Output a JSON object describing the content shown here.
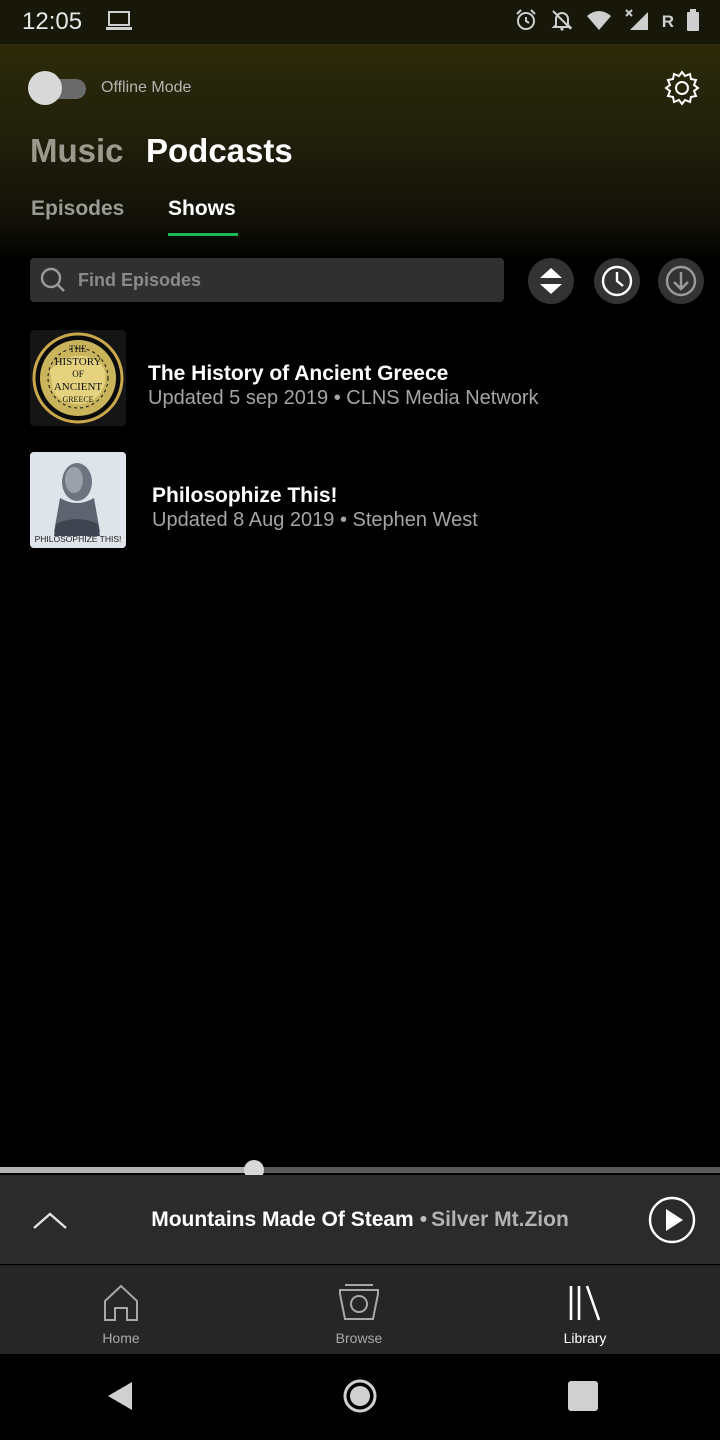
{
  "status_bar": {
    "time": "12:05",
    "carrier_indicator": "R",
    "icons": [
      "laptop-icon",
      "alarm-icon",
      "notifications-off-icon",
      "wifi-icon",
      "cell-signal-icon",
      "battery-icon"
    ]
  },
  "header": {
    "offline_mode": {
      "label": "Offline Mode",
      "enabled": false
    },
    "main_tabs": [
      {
        "label": "Music",
        "active": false
      },
      {
        "label": "Podcasts",
        "active": true
      }
    ],
    "sub_tabs": [
      {
        "label": "Episodes",
        "active": false
      },
      {
        "label": "Shows",
        "active": true
      }
    ],
    "accent_color": "#1db954"
  },
  "search": {
    "placeholder": "Find Episodes",
    "value": ""
  },
  "toolbar": {
    "buttons": [
      "sort-icon",
      "recent-clock-icon",
      "download-icon"
    ]
  },
  "shows": [
    {
      "title": "The History of Ancient Greece",
      "meta": "Updated 5 sep 2019 • CLNS Media Network",
      "cover_text": [
        "THE",
        "HISTORY",
        "OF",
        "ANCIENT",
        "GREECE"
      ]
    },
    {
      "title": "Philosophize This!",
      "meta": "Updated 8 Aug 2019 • Stephen West",
      "cover_text": [
        "PHILOSOPHIZE THIS!"
      ]
    }
  ],
  "now_playing": {
    "title": "Mountains Made Of Steam",
    "separator": "•",
    "artist": "Silver Mt.Zion",
    "progress": 0.353
  },
  "bottom_nav": {
    "items": [
      {
        "label": "Home",
        "icon": "home-icon",
        "active": false
      },
      {
        "label": "Browse",
        "icon": "browse-icon",
        "active": false
      },
      {
        "label": "Library",
        "icon": "library-icon",
        "active": true
      }
    ]
  }
}
